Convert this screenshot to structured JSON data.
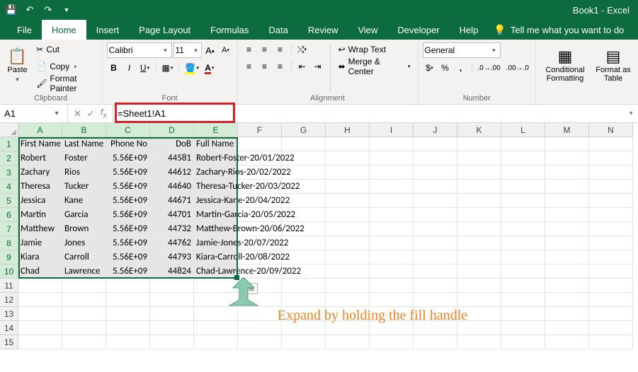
{
  "titlebar_right": "Book1 - Excel",
  "tabs": [
    "File",
    "Home",
    "Insert",
    "Page Layout",
    "Formulas",
    "Data",
    "Review",
    "View",
    "Developer",
    "Help"
  ],
  "active_tab": 1,
  "tell_me": "Tell me what you want to do",
  "ribbon": {
    "clipboard": {
      "paste": "Paste",
      "cut": "Cut",
      "copy": "Copy",
      "fpainter": "Format Painter",
      "label": "Clipboard"
    },
    "font": {
      "name": "Calibri",
      "size": "11",
      "label": "Font"
    },
    "alignment": {
      "wrap": "Wrap Text",
      "merge": "Merge & Center",
      "label": "Alignment"
    },
    "number": {
      "format": "General",
      "label": "Number"
    },
    "styles": {
      "cf": "Conditional Formatting",
      "table": "Format as Table"
    }
  },
  "namebox": "A1",
  "formula": "=Sheet1!A1",
  "columns": [
    "A",
    "B",
    "C",
    "D",
    "E",
    "F",
    "G",
    "H",
    "I",
    "J",
    "K",
    "L",
    "M",
    "N"
  ],
  "rows": [
    {
      "n": "1",
      "sel": true,
      "cells": [
        "First Name",
        "Last Name",
        "Phone No",
        "DoB",
        "Full Name",
        "",
        "",
        "",
        "",
        "",
        "",
        "",
        "",
        ""
      ],
      "selcols": 5
    },
    {
      "n": "2",
      "sel": true,
      "cells": [
        "Robert",
        "Foster",
        "5.56E+09",
        "44581",
        "Robert-Foster-20/01/2022",
        "",
        "",
        "",
        "",
        "",
        "",
        "",
        "",
        ""
      ],
      "selcols": 5
    },
    {
      "n": "3",
      "sel": true,
      "cells": [
        "Zachary",
        "Rios",
        "5.56E+09",
        "44612",
        "Zachary-Rios-20/02/2022",
        "",
        "",
        "",
        "",
        "",
        "",
        "",
        "",
        ""
      ],
      "selcols": 5
    },
    {
      "n": "4",
      "sel": true,
      "cells": [
        "Theresa",
        "Tucker",
        "5.56E+09",
        "44640",
        "Theresa-Tucker-20/03/2022",
        "",
        "",
        "",
        "",
        "",
        "",
        "",
        "",
        ""
      ],
      "selcols": 5
    },
    {
      "n": "5",
      "sel": true,
      "cells": [
        "Jessica",
        "Kane",
        "5.56E+09",
        "44671",
        "Jessica-Kane-20/04/2022",
        "",
        "",
        "",
        "",
        "",
        "",
        "",
        "",
        ""
      ],
      "selcols": 5
    },
    {
      "n": "6",
      "sel": true,
      "cells": [
        "Martin",
        "Garcia",
        "5.56E+09",
        "44701",
        "Martin-Garcia-20/05/2022",
        "",
        "",
        "",
        "",
        "",
        "",
        "",
        "",
        ""
      ],
      "selcols": 5
    },
    {
      "n": "7",
      "sel": true,
      "cells": [
        "Matthew",
        "Brown",
        "5.56E+09",
        "44732",
        "Matthew-Brown-20/06/2022",
        "",
        "",
        "",
        "",
        "",
        "",
        "",
        "",
        ""
      ],
      "selcols": 5
    },
    {
      "n": "8",
      "sel": true,
      "cells": [
        "Jamie",
        "Jones",
        "5.56E+09",
        "44762",
        "Jamie-Jones-20/07/2022",
        "",
        "",
        "",
        "",
        "",
        "",
        "",
        "",
        ""
      ],
      "selcols": 5
    },
    {
      "n": "9",
      "sel": true,
      "cells": [
        "Kiara",
        "Carroll",
        "5.56E+09",
        "44793",
        "Kiara-Carroll-20/08/2022",
        "",
        "",
        "",
        "",
        "",
        "",
        "",
        "",
        ""
      ],
      "selcols": 5
    },
    {
      "n": "10",
      "sel": true,
      "cells": [
        "Chad",
        "Lawrence",
        "5.56E+09",
        "44824",
        "Chad-Lawrence-20/09/2022",
        "",
        "",
        "",
        "",
        "",
        "",
        "",
        "",
        ""
      ],
      "selcols": 5
    },
    {
      "n": "11",
      "cells": [
        "",
        "",
        "",
        "",
        "",
        "",
        "",
        "",
        "",
        "",
        "",
        "",
        "",
        ""
      ]
    },
    {
      "n": "12",
      "cells": [
        "",
        "",
        "",
        "",
        "",
        "",
        "",
        "",
        "",
        "",
        "",
        "",
        "",
        ""
      ]
    },
    {
      "n": "13",
      "cells": [
        "",
        "",
        "",
        "",
        "",
        "",
        "",
        "",
        "",
        "",
        "",
        "",
        "",
        ""
      ]
    },
    {
      "n": "14",
      "cells": [
        "",
        "",
        "",
        "",
        "",
        "",
        "",
        "",
        "",
        "",
        "",
        "",
        "",
        ""
      ]
    },
    {
      "n": "15",
      "cells": [
        "",
        "",
        "",
        "",
        "",
        "",
        "",
        "",
        "",
        "",
        "",
        "",
        "",
        ""
      ]
    }
  ],
  "numeric_cols": [
    2,
    3
  ],
  "selected_col_count": 5,
  "over_col": 4,
  "callout": "Expand by holding the fill handle"
}
